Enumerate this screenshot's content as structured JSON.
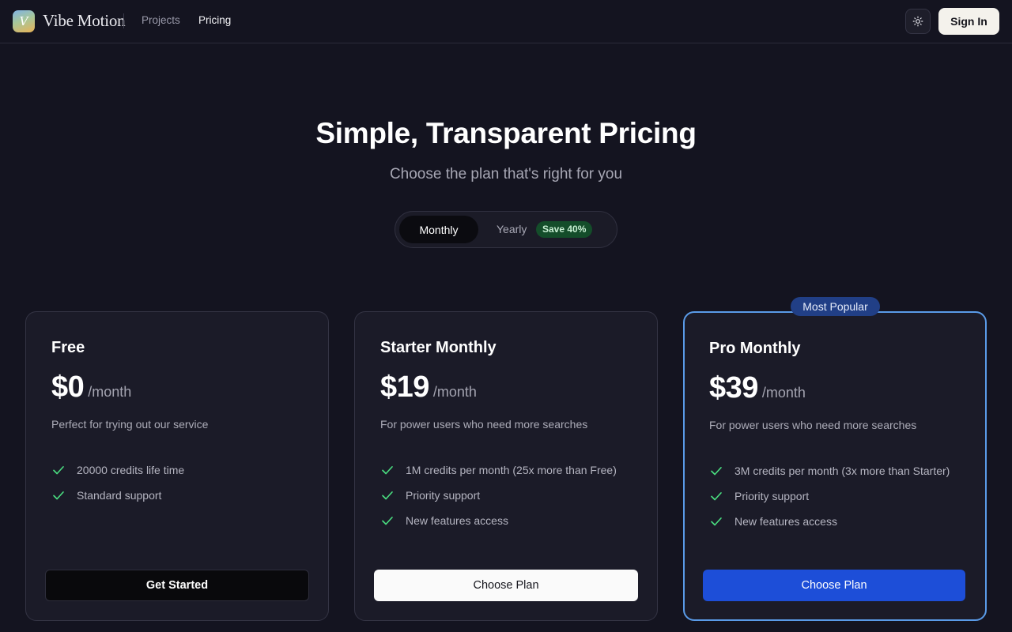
{
  "header": {
    "logo_letter": "V",
    "brand": "Vibe Motion",
    "nav": {
      "projects": "Projects",
      "pricing": "Pricing"
    },
    "theme_icon": "sun-icon",
    "signin": "Sign In"
  },
  "hero": {
    "title": "Simple, Transparent Pricing",
    "subtitle": "Choose the plan that's right for you"
  },
  "billing_toggle": {
    "monthly": "Monthly",
    "yearly": "Yearly",
    "save_badge": "Save 40%",
    "selected": "Monthly"
  },
  "plans": [
    {
      "name": "Free",
      "price": "$0",
      "period": "/month",
      "description": "Perfect for trying out our service",
      "features": [
        "20000 credits life time",
        "Standard support"
      ],
      "button": "Get Started"
    },
    {
      "name": "Starter Monthly",
      "price": "$19",
      "period": "/month",
      "description": "For power users who need more searches",
      "features": [
        "1M credits per month (25x more than Free)",
        "Priority support",
        "New features access"
      ],
      "button": "Choose Plan"
    },
    {
      "name": "Pro Monthly",
      "price": "$39",
      "period": "/month",
      "description": "For power users who need more searches",
      "features": [
        "3M credits per month (3x more than Starter)",
        "Priority support",
        "New features access"
      ],
      "button": "Choose Plan",
      "badge": "Most Popular"
    }
  ],
  "colors": {
    "background": "#141420",
    "card": "#1b1b28",
    "accent_blue": "#1d4ed8",
    "popular_border": "#5a9be8",
    "check_green": "#4ade80",
    "save_badge_bg": "#144d2a"
  }
}
